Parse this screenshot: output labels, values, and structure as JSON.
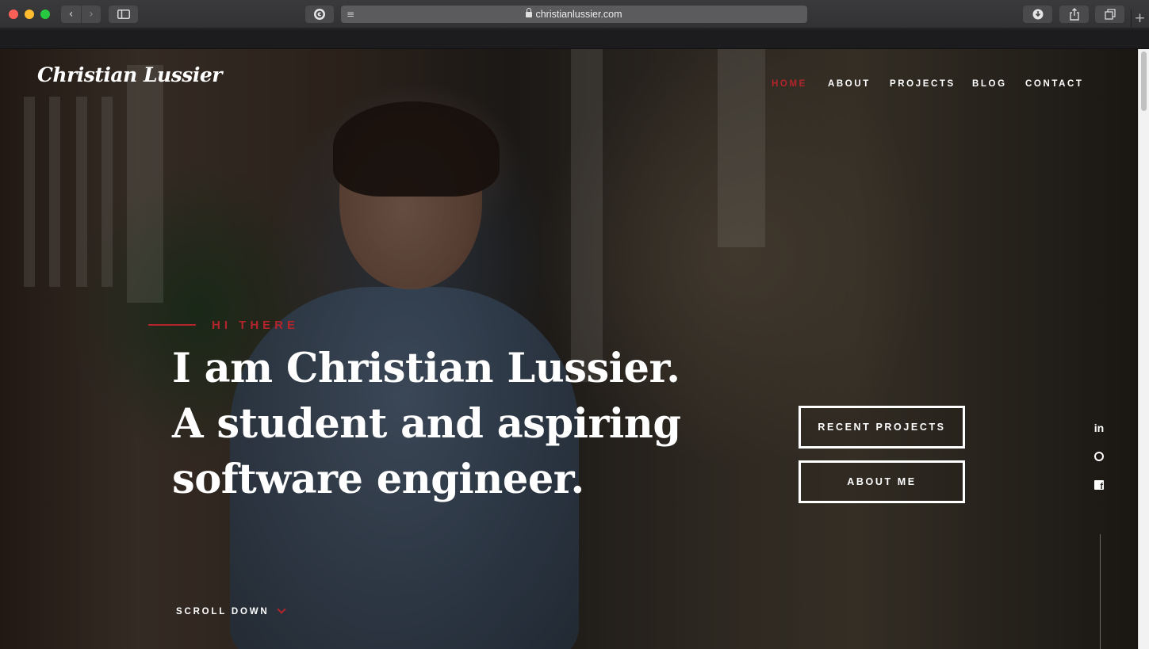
{
  "browser": {
    "url": "christianlussier.com",
    "icons": {
      "close": "close-icon",
      "minimize": "minimize-icon",
      "zoom": "zoom-icon",
      "back": "back-arrow-icon",
      "forward": "forward-arrow-icon",
      "sidebar": "sidebar-icon",
      "grammarly": "grammarly-icon",
      "reader": "reader-icon",
      "lock": "lock-icon",
      "download": "download-icon",
      "share": "share-icon",
      "tabs": "tab-overview-icon",
      "new_tab": "plus-icon"
    },
    "glyphs": {
      "back": "‹",
      "forward": "›",
      "reader": "≡",
      "new_tab": "+"
    }
  },
  "site": {
    "logo": "Christian Lussier",
    "nav": [
      {
        "label": "HOME",
        "active": true
      },
      {
        "label": "ABOUT",
        "active": false
      },
      {
        "label": "PROJECTS",
        "active": false
      },
      {
        "label": "BLOG",
        "active": false
      },
      {
        "label": "CONTACT",
        "active": false
      }
    ],
    "hero": {
      "eyebrow": "HI THERE",
      "headline_lines": [
        "I am Christian Lussier.",
        "A student and aspiring",
        "software engineer."
      ],
      "buttons": {
        "recent_projects": "RECENT PROJECTS",
        "about_me": "ABOUT ME"
      },
      "scroll_label": "SCROLL DOWN",
      "social": [
        {
          "name": "linkedin-icon",
          "label": "in"
        },
        {
          "name": "github-icon"
        },
        {
          "name": "facebook-icon"
        }
      ]
    },
    "colors": {
      "accent": "#b3252b",
      "text": "#ffffff"
    }
  }
}
